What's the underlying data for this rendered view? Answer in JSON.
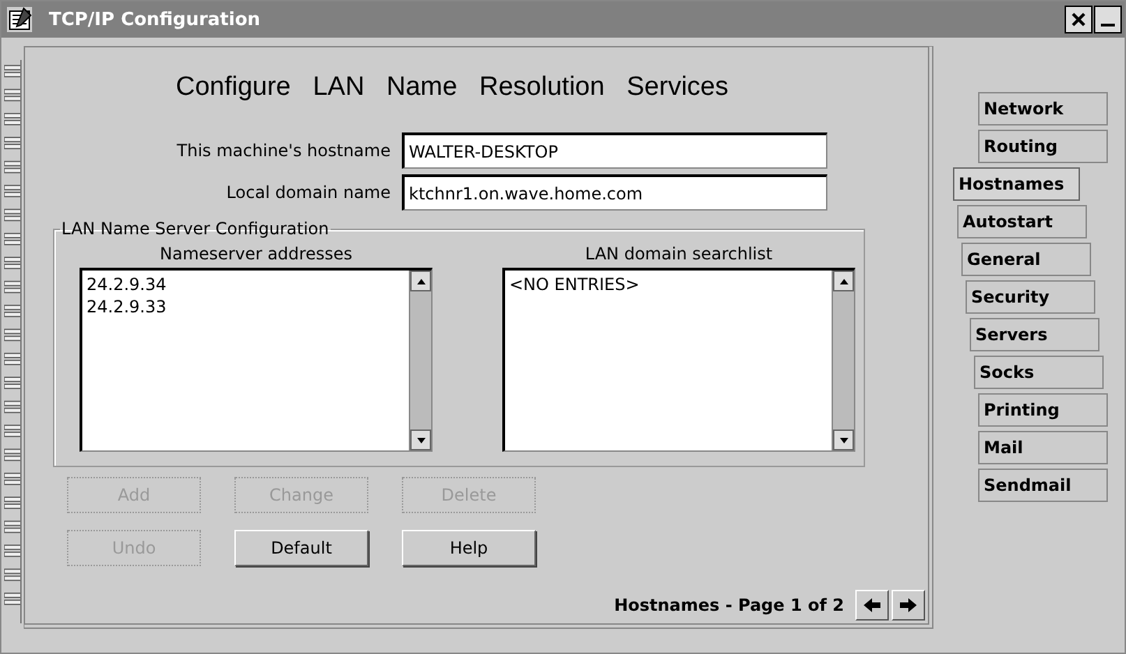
{
  "window": {
    "title": "TCP/IP Configuration"
  },
  "page": {
    "heading": "Configure   LAN   Name   Resolution   Services",
    "fields": [
      {
        "label": "This machine's hostname",
        "value": "WALTER-DESKTOP"
      },
      {
        "label": "Local domain name",
        "value": "ktchnr1.on.wave.home.com"
      }
    ],
    "group": {
      "title": "LAN Name Server Configuration",
      "lists": [
        {
          "label": "Nameserver addresses",
          "items": [
            "24.2.9.34",
            "24.2.9.33"
          ]
        },
        {
          "label": "LAN domain searchlist",
          "items": [
            "<NO ENTRIES>"
          ]
        }
      ]
    },
    "button_rows": [
      [
        {
          "label": "Add",
          "disabled": true
        },
        {
          "label": "Change",
          "disabled": true
        },
        {
          "label": "Delete",
          "disabled": true
        }
      ],
      [
        {
          "label": "Undo",
          "disabled": true
        },
        {
          "label": "Default",
          "disabled": false
        },
        {
          "label": "Help",
          "disabled": false
        }
      ]
    ],
    "page_status": "Hostnames - Page 1 of 2"
  },
  "tabs": [
    {
      "label": "Network",
      "selected": false
    },
    {
      "label": "Routing",
      "selected": false
    },
    {
      "label": "Hostnames",
      "selected": true
    },
    {
      "label": "Autostart",
      "selected": false
    },
    {
      "label": "General",
      "selected": false
    },
    {
      "label": "Security",
      "selected": false
    },
    {
      "label": "Servers",
      "selected": false
    },
    {
      "label": "Socks",
      "selected": false
    },
    {
      "label": "Printing",
      "selected": false
    },
    {
      "label": "Mail",
      "selected": false
    },
    {
      "label": "Sendmail",
      "selected": false
    }
  ]
}
